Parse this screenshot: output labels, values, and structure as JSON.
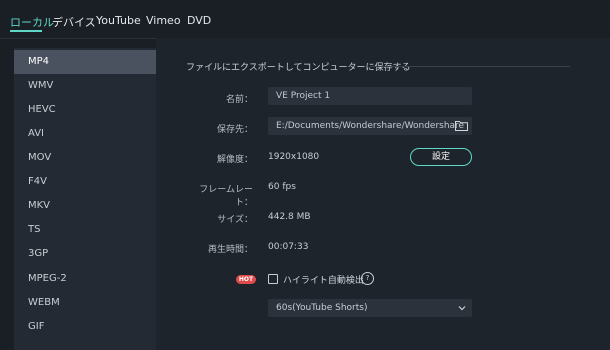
{
  "tabs": [
    {
      "label": "ローカル",
      "active": true
    },
    {
      "label": "デバイス",
      "active": false
    },
    {
      "label": "YouTube",
      "active": false
    },
    {
      "label": "Vimeo",
      "active": false
    },
    {
      "label": "DVD",
      "active": false
    }
  ],
  "formats": [
    "MP4",
    "WMV",
    "HEVC",
    "AVI",
    "MOV",
    "F4V",
    "MKV",
    "TS",
    "3GP",
    "MPEG-2",
    "WEBM",
    "GIF"
  ],
  "selected_format": "MP4",
  "section_title": "ファイルにエクスポートしてコンピューターに保存する",
  "fields": {
    "name": {
      "label": "名前：",
      "value": "VE Project 1"
    },
    "save_to": {
      "label": "保存先：",
      "value": "E:/Documents/Wondershare/Wondershare"
    },
    "resolution": {
      "label": "解像度：",
      "value": "1920x1080",
      "button": "設定"
    },
    "frame_rate": {
      "label": "フレームレート：",
      "value": "60 fps"
    },
    "size": {
      "label": "サイズ：",
      "value": "442.8 MB"
    },
    "duration": {
      "label": "再生時間：",
      "value": "00:07:33"
    }
  },
  "highlight": {
    "badge": "HOT",
    "label": "ハイライト自動検出",
    "checked": false,
    "help": "?"
  },
  "highlight_select": {
    "value": "60s(YouTube Shorts)"
  },
  "colors": {
    "accent": "#5fd8c8",
    "hot": "#e04a4a",
    "selected_row": "#4a5260"
  }
}
